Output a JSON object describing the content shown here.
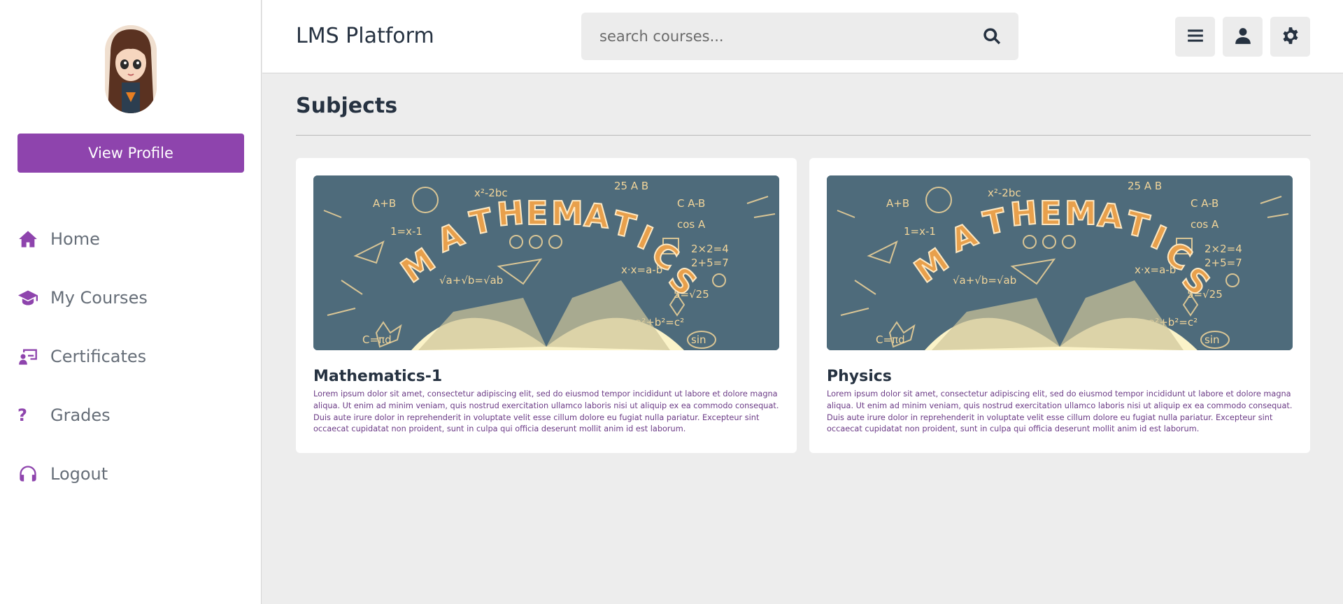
{
  "sidebar": {
    "view_profile_label": "View Profile",
    "items": [
      {
        "label": "Home",
        "icon": "home-icon"
      },
      {
        "label": "My Courses",
        "icon": "graduation-cap-icon"
      },
      {
        "label": "Certificates",
        "icon": "certificate-icon"
      },
      {
        "label": "Grades",
        "icon": "question-icon"
      },
      {
        "label": "Logout",
        "icon": "headset-icon"
      }
    ]
  },
  "header": {
    "brand": "LMS Platform",
    "search_placeholder": "search courses...",
    "buttons": [
      "menu-icon",
      "user-icon",
      "settings-icon"
    ]
  },
  "main": {
    "title": "Subjects",
    "cards": [
      {
        "title": "Mathematics-1",
        "image_text": "MATHEMATICS",
        "description": "Lorem ipsum dolor sit amet, consectetur adipiscing elit, sed do eiusmod tempor incididunt ut labore et dolore magna aliqua. Ut enim ad minim veniam, quis nostrud exercitation ullamco laboris nisi ut aliquip ex ea commodo consequat. Duis aute irure dolor in reprehenderit in voluptate velit esse cillum dolore eu fugiat nulla pariatur. Excepteur sint occaecat cupidatat non proident, sunt in culpa qui officia deserunt mollit anim id est laborum."
      },
      {
        "title": "Physics",
        "image_text": "MATHEMATICS",
        "description": "Lorem ipsum dolor sit amet, consectetur adipiscing elit, sed do eiusmod tempor incididunt ut labore et dolore magna aliqua. Ut enim ad minim veniam, quis nostrud exercitation ullamco laboris nisi ut aliquip ex ea commodo consequat. Duis aute irure dolor in reprehenderit in voluptate velit esse cillum dolore eu fugiat nulla pariatur. Excepteur sint occaecat cupidatat non proident, sunt in culpa qui officia deserunt mollit anim id est laborum."
      }
    ]
  },
  "colors": {
    "accent": "#8e44ad",
    "text_dark": "#263241",
    "background": "#ededed",
    "card_image_bg": "#4e6b7b",
    "image_letters": "#e8a04c"
  }
}
